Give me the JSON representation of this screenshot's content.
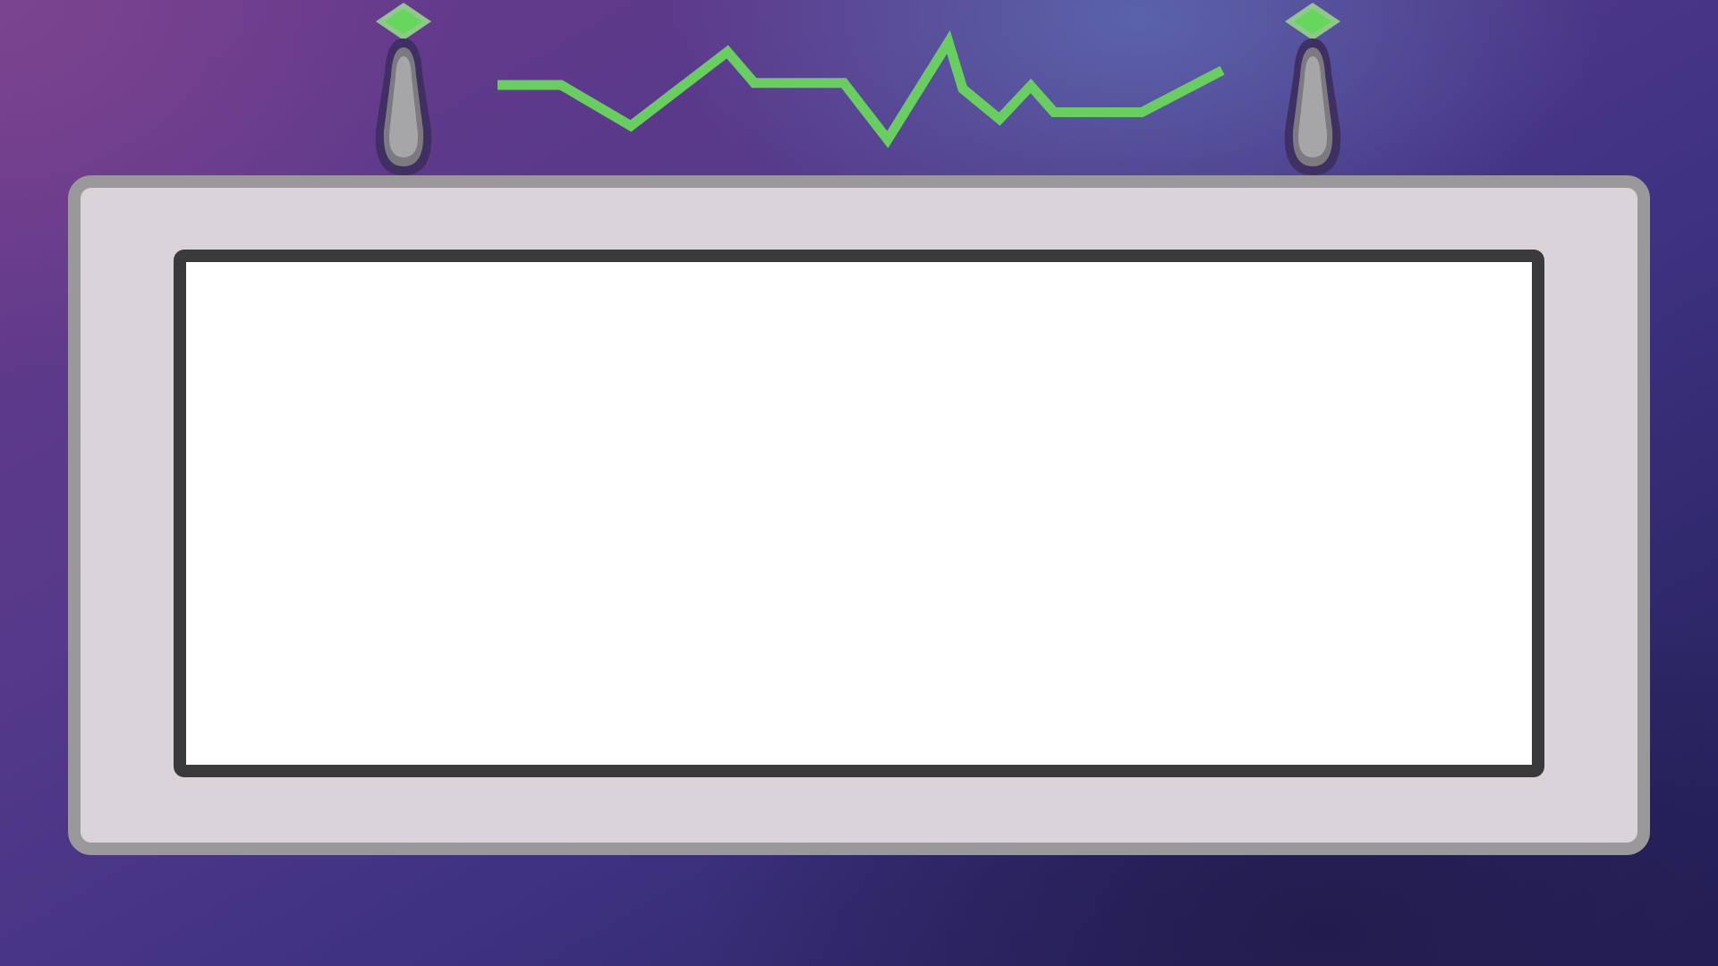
{
  "colors": {
    "waveform": "#6acd62",
    "indicator": "#66d65c",
    "indicator_halo": "#8fc88a",
    "lever_body": "#a6a5a7",
    "lever_rim": "#7c7a80",
    "lever_outline": "#3f2f63",
    "panel_fill": "#dad3da",
    "panel_border": "#9b989c",
    "screen_fill": "#ffffff",
    "screen_border": "#3a393b"
  },
  "levers": [
    {
      "name": "left-lever",
      "indicator": "on"
    },
    {
      "name": "right-lever",
      "indicator": "on"
    }
  ],
  "signal": {
    "values": [
      0.56,
      0.56,
      0.14,
      0.9,
      0.58,
      0.58,
      0.0,
      1.0,
      0.52,
      0.21,
      0.55,
      0.28,
      0.28,
      0.71
    ]
  },
  "screen": {
    "text": ""
  }
}
